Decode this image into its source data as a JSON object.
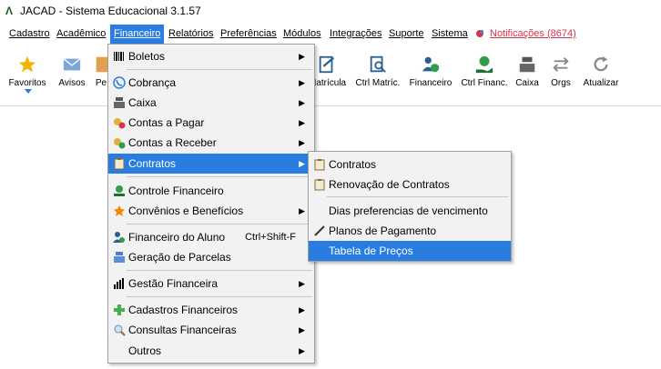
{
  "window": {
    "title": "JACAD - Sistema Educacional 3.1.57"
  },
  "menubar": [
    {
      "label": "Cadastro"
    },
    {
      "label": "Acadêmico"
    },
    {
      "label": "Financeiro"
    },
    {
      "label": "Relatórios"
    },
    {
      "label": "Preferências"
    },
    {
      "label": "Módulos"
    },
    {
      "label": "Integrações"
    },
    {
      "label": "Suporte"
    },
    {
      "label": "Sistema"
    },
    {
      "label": "Notificações (8674)"
    }
  ],
  "toolbar": [
    {
      "label": "Favoritos",
      "icon": "star-icon"
    },
    {
      "label": "Avisos",
      "icon": "mail-icon"
    },
    {
      "label": "Pe",
      "icon": "book-icon"
    },
    {
      "label": "Matrícula",
      "icon": "edit-document-icon"
    },
    {
      "label": "Ctrl Matríc.",
      "icon": "search-document-icon"
    },
    {
      "label": "Financeiro",
      "icon": "user-money-icon"
    },
    {
      "label": "Ctrl Financ.",
      "icon": "hand-money-icon"
    },
    {
      "label": "Caixa",
      "icon": "cash-register-icon"
    },
    {
      "label": "Orgs",
      "icon": "transfer-arrows-icon"
    },
    {
      "label": "Atualizar",
      "icon": "refresh-icon"
    }
  ],
  "financeiro_menu": [
    {
      "label": "Boletos",
      "icon": "barcode-icon",
      "submenu": true
    },
    {
      "label": "Cobrança",
      "icon": "phone-icon",
      "submenu": true
    },
    {
      "label": "Caixa",
      "icon": "cash-register-icon",
      "submenu": true
    },
    {
      "label": "Contas a Pagar",
      "icon": "coins-minus-icon",
      "submenu": true
    },
    {
      "label": "Contas a Receber",
      "icon": "coins-plus-icon",
      "submenu": true
    },
    {
      "label": "Contratos",
      "icon": "clipboard-icon",
      "submenu": true,
      "highlighted": true
    },
    {
      "label": "Controle Financeiro",
      "icon": "hand-money-icon",
      "submenu": false
    },
    {
      "label": "Convênios e Benefícios",
      "icon": "star-icon",
      "submenu": true
    },
    {
      "label": "Financeiro do Aluno",
      "icon": "user-money-icon",
      "shortcut": "Ctrl+Shift-F",
      "submenu": false
    },
    {
      "label": "Geração de Parcelas",
      "icon": "cash-register-icon",
      "submenu": false
    },
    {
      "label": "Gestão Financeira",
      "icon": "bar-chart-icon",
      "submenu": true
    },
    {
      "label": "Cadastros Financeiros",
      "icon": "plus-icon",
      "submenu": true
    },
    {
      "label": "Consultas Financeiras",
      "icon": "magnifier-icon",
      "submenu": true
    },
    {
      "label": "Outros",
      "icon": "",
      "submenu": true
    }
  ],
  "contratos_menu": [
    {
      "label": "Contratos",
      "icon": "clipboard-icon"
    },
    {
      "label": "Renovação de Contratos",
      "icon": "clipboard-icon"
    },
    {
      "label": "Dias preferencias de vencimento",
      "icon": ""
    },
    {
      "label": "Planos de Pagamento",
      "icon": "pen-icon"
    },
    {
      "label": "Tabela de Preços",
      "icon": "",
      "highlighted": true
    }
  ],
  "colors": {
    "highlight": "#2a7de0",
    "notification": "#d9344d",
    "menu_bg": "#f2f2f2"
  }
}
